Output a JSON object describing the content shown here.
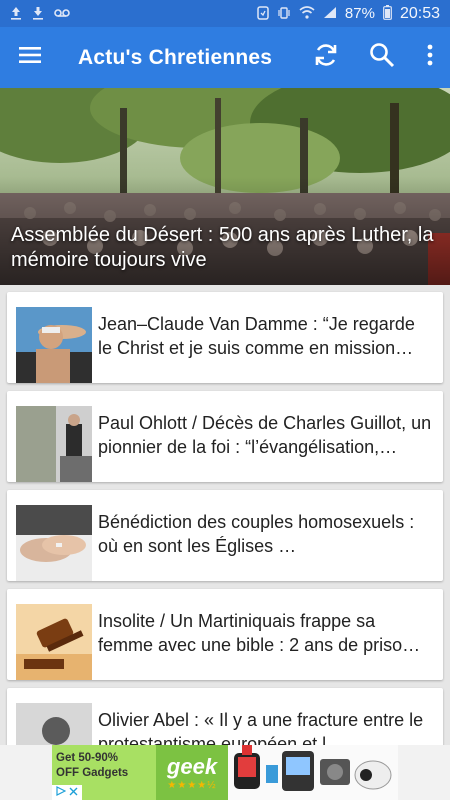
{
  "status_bar": {
    "battery": "87%",
    "time": "20:53"
  },
  "app_bar": {
    "title": "Actu's Chretiennes"
  },
  "featured": {
    "caption": "Assemblée du Désert : 500 ans après Luther, la mémoire toujours vive"
  },
  "articles": [
    {
      "title": "Jean–Claude Van Damme : “Je regarde le Christ et je suis comme en mission…"
    },
    {
      "title": "Paul Ohlott / Décès de Charles Guillot, un pionnier de la foi : “l’évangélisation,…"
    },
    {
      "title": "Bénédiction des couples homosexuels : où en sont les Églises …"
    },
    {
      "title": "Insolite / Un Martiniquais frappe sa femme avec une bible : 2 ans de priso…"
    },
    {
      "title": "Olivier Abel : « Il y a une fracture entre le protestantisme européen et l…"
    }
  ],
  "ad": {
    "line1": "Get 50-90%",
    "line2": "OFF Gadgets",
    "brand": "geek",
    "rating": "★★★★½"
  },
  "colors": {
    "status_bar": "#2b6fcf",
    "app_bar": "#2f7de1",
    "background": "#e6e6e6"
  }
}
